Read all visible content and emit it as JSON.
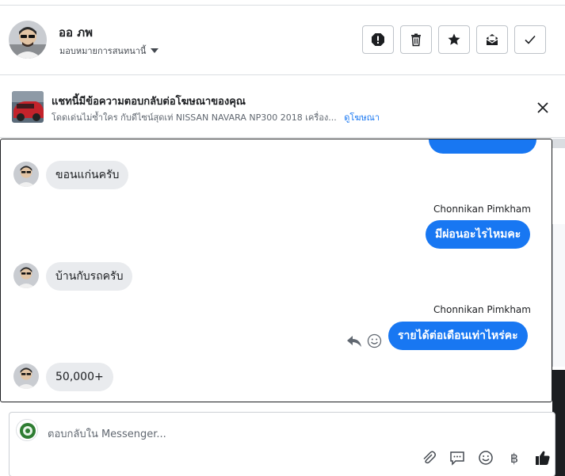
{
  "header": {
    "name": "ออ ภพ",
    "subtitle": "มอบหมายการสนทนานี้",
    "actions": [
      {
        "icon": "alert-icon"
      },
      {
        "icon": "trash-icon"
      },
      {
        "icon": "star-icon"
      },
      {
        "icon": "mark-unread-icon"
      },
      {
        "icon": "checkmark-icon"
      }
    ]
  },
  "ad": {
    "title": "แชทนี้มีข้อความตอบกลับต่อโฆษณาของคุณ",
    "description": "โดดเด่นไม่ซ้ำใคร กับดีไซน์สุดเท่ NISSAN NAVARA NP300 2018 เครื่อง...",
    "link": "ดูโฆษณา"
  },
  "messages": [
    {
      "direction": "in",
      "text": "ขอนแก่นครับ"
    },
    {
      "direction": "out",
      "sender": "Chonnikan Pimkham",
      "text": "มีผ่อนอะไรไหมคะ"
    },
    {
      "direction": "in",
      "text": "บ้านกับรถครับ"
    },
    {
      "direction": "out",
      "sender": "Chonnikan Pimkham",
      "text": "รายได้ต่อเดือนเท่าไหร่คะ"
    },
    {
      "direction": "in",
      "text": "50,000+"
    }
  ],
  "composer": {
    "placeholder": "ตอบกลับใน Messenger...",
    "currency_symbol": "฿"
  },
  "colors": {
    "accent": "#1877f2",
    "incoming_bubble": "#e9ebee"
  }
}
